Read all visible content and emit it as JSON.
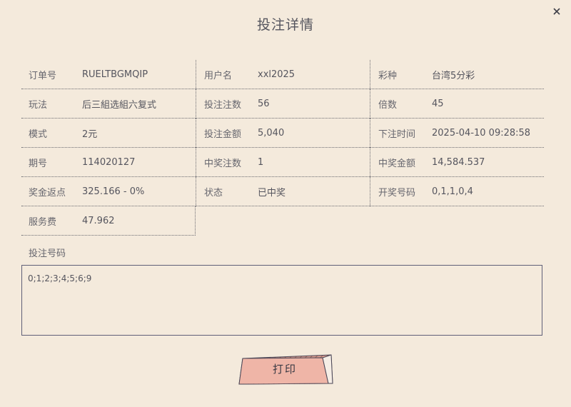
{
  "dialog": {
    "title": "投注详情",
    "close_icon": "close-icon"
  },
  "details": [
    [
      {
        "label": "订单号",
        "value": "RUELTBGMQIP"
      },
      {
        "label": "用户名",
        "value": "xxl2025"
      },
      {
        "label": "彩种",
        "value": "台湾5分彩"
      }
    ],
    [
      {
        "label": "玩法",
        "value": "后三組选組六复式"
      },
      {
        "label": "投注注数",
        "value": "56"
      },
      {
        "label": "倍数",
        "value": "45"
      }
    ],
    [
      {
        "label": "模式",
        "value": "2元"
      },
      {
        "label": "投注金额",
        "value": "5,040"
      },
      {
        "label": "下注时间",
        "value": "2025-04-10 09:28:58"
      }
    ],
    [
      {
        "label": "期号",
        "value": "114020127"
      },
      {
        "label": "中奖注数",
        "value": "1"
      },
      {
        "label": "中奖金额",
        "value": "14,584.537"
      }
    ],
    [
      {
        "label": "奖金返点",
        "value": "325.166 - 0%"
      },
      {
        "label": "状态",
        "value": "已中奖"
      },
      {
        "label": "开奖号码",
        "value": "0,1,1,0,4"
      }
    ],
    [
      {
        "label": "服务费",
        "value": "47.962"
      }
    ]
  ],
  "bet_numbers": {
    "label": "投注号码",
    "value": "0;1;2;3;4;5;6;9"
  },
  "print_button": {
    "label": "打印"
  },
  "colors": {
    "background": "#f4eadc",
    "button_fill": "#efb5a7",
    "border": "#5f6078"
  }
}
